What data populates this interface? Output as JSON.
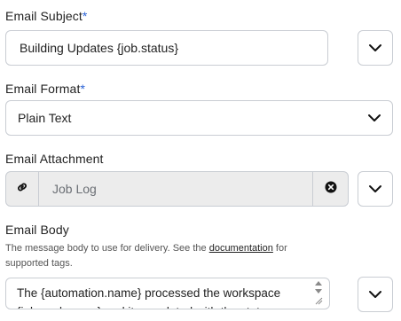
{
  "subject": {
    "label": "Email Subject",
    "required_mark": "*",
    "value": "Building Updates {job.status}"
  },
  "format": {
    "label": "Email Format",
    "required_mark": "*",
    "selected": "Plain Text"
  },
  "attachment": {
    "label": "Email Attachment",
    "value": "Job Log"
  },
  "body": {
    "label": "Email Body",
    "help_prefix": "The message body to use for delivery. See the ",
    "help_link": "documentation",
    "help_suffix": " for supported tags.",
    "value": "The {automation.name} processed the workspace {job.workspace} and it completed with the status"
  },
  "colors": {
    "required": "#2a62d6",
    "border": "#c9cdd3",
    "disabled_bg": "#ececec"
  },
  "icons": [
    "chevron-down-icon",
    "link-icon",
    "clear-icon",
    "resize-handle-icon"
  ]
}
